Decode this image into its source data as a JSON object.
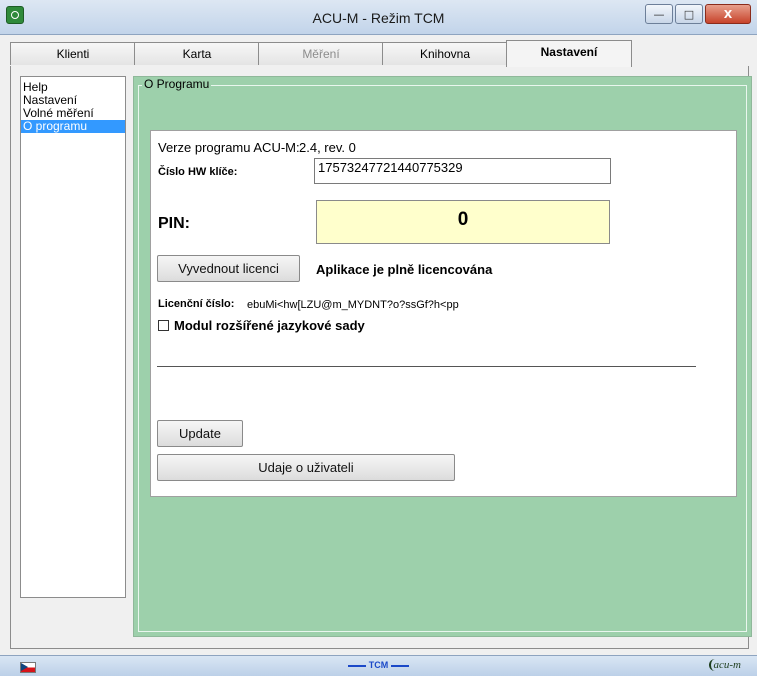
{
  "window": {
    "title": "ACU-M - Režim TCM",
    "minimize_glyph": "—",
    "maximize_glyph": "□",
    "close_glyph": "X"
  },
  "tabs": [
    {
      "label": "Klienti",
      "state": "normal"
    },
    {
      "label": "Karta",
      "state": "normal"
    },
    {
      "label": "Měření",
      "state": "disabled"
    },
    {
      "label": "Knihovna",
      "state": "normal"
    },
    {
      "label": "Nastavení",
      "state": "active"
    }
  ],
  "sidebar": {
    "items": [
      {
        "label": "Help"
      },
      {
        "label": "Nastavení"
      },
      {
        "label": "Volné měření"
      },
      {
        "label": "O programu",
        "selected": true
      }
    ]
  },
  "group": {
    "title": "O Programu"
  },
  "info": {
    "version_label": "Verze programu ACU-M:",
    "version_value": "2.4, rev. 0",
    "hw_key_label": "Číslo HW klíče:",
    "hw_key_value": "17573247721440775329",
    "pin_label": "PIN:",
    "pin_value": "0",
    "license_button": "Vyvednout licenci",
    "license_status": "Aplikace je plně licencována",
    "license_number_label": "Licenční číslo:",
    "license_number_value": "ebuMi<hw[LZU@m_MYDNT?o?ssGf?h<pp",
    "module_checkbox_label": "Modul rozšířené jazykové sady",
    "module_checked": false,
    "update_button": "Update",
    "user_button": "Udaje o uživateli"
  },
  "statusbar": {
    "center_text": "TCM",
    "logo_text": "acu-m"
  },
  "colors": {
    "group_background": "#9dd0ab",
    "pin_background": "#ffffcc",
    "selection": "#3399ff"
  }
}
